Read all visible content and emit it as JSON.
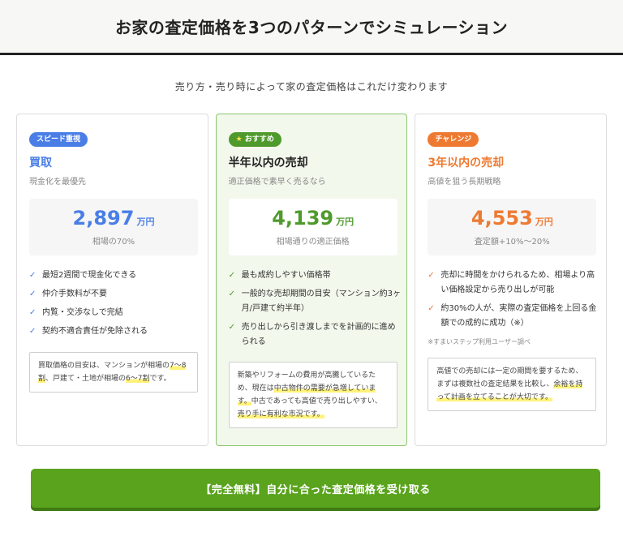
{
  "header": {
    "title": "お家の査定価格を3つのパターンでシミュレーション"
  },
  "subtitle": "売り方・売り時によって家の査定価格はこれだけ変わります",
  "cards": [
    {
      "badge": "スピード重視",
      "title": "買取",
      "subtitle": "現金化を最優先",
      "price": "2,897",
      "unit": "万円",
      "price_note": "相場の70%",
      "features": [
        "最短2週間で現金化できる",
        "仲介手数料が不要",
        "内覧・交渉なしで完結",
        "契約不適合責任が免除される"
      ],
      "note_parts": [
        "買取価格の目安は、マンションが相場の",
        "7〜8割",
        "、戸建て・土地が相場の",
        "6〜7割",
        "です。"
      ]
    },
    {
      "badge": "おすすめ",
      "badge_icon": "★",
      "title": "半年以内の売却",
      "subtitle": "適正価格で素早く売るなら",
      "price": "4,139",
      "unit": "万円",
      "price_note": "相場通りの適正価格",
      "features": [
        "最も成約しやすい価格帯",
        "一般的な売却期間の目安（マンション約3ヶ月/戸建て約半年）",
        "売り出しから引き渡しまでを計画的に進められる"
      ],
      "note_parts": [
        "新築やリフォームの費用が高騰しているため、現在は",
        "中古物件の需要が急増しています。",
        "中古であっても高値で売り出しやすい、",
        "売り手に有利な市況です。"
      ]
    },
    {
      "badge": "チャレンジ",
      "title": "3年以内の売却",
      "subtitle": "高値を狙う長期戦略",
      "price": "4,553",
      "unit": "万円",
      "price_note": "査定額+10%〜20%",
      "features": [
        "売却に時間をかけられるため、相場より高い価格設定から売り出しが可能",
        "約30%の人が、実際の査定価格を上回る金額での成約に成功（※）"
      ],
      "footnote": "※すまいステップ利用ユーザー調べ",
      "note_parts": [
        "高値での売却には一定の期間を要するため、まずは複数社の査定結果を比較し、",
        "余裕を持って計画を立てることが大切です。"
      ]
    }
  ],
  "cta": {
    "label": "【完全無料】自分に合った査定価格を受け取る"
  },
  "colors": {
    "blue": "#4a7ee6",
    "green": "#4f9a2c",
    "orange": "#ee7a32",
    "cta": "#5aa31d",
    "highlight": "#fff27a"
  },
  "icons": {
    "check": "check-icon",
    "star": "star-icon"
  }
}
